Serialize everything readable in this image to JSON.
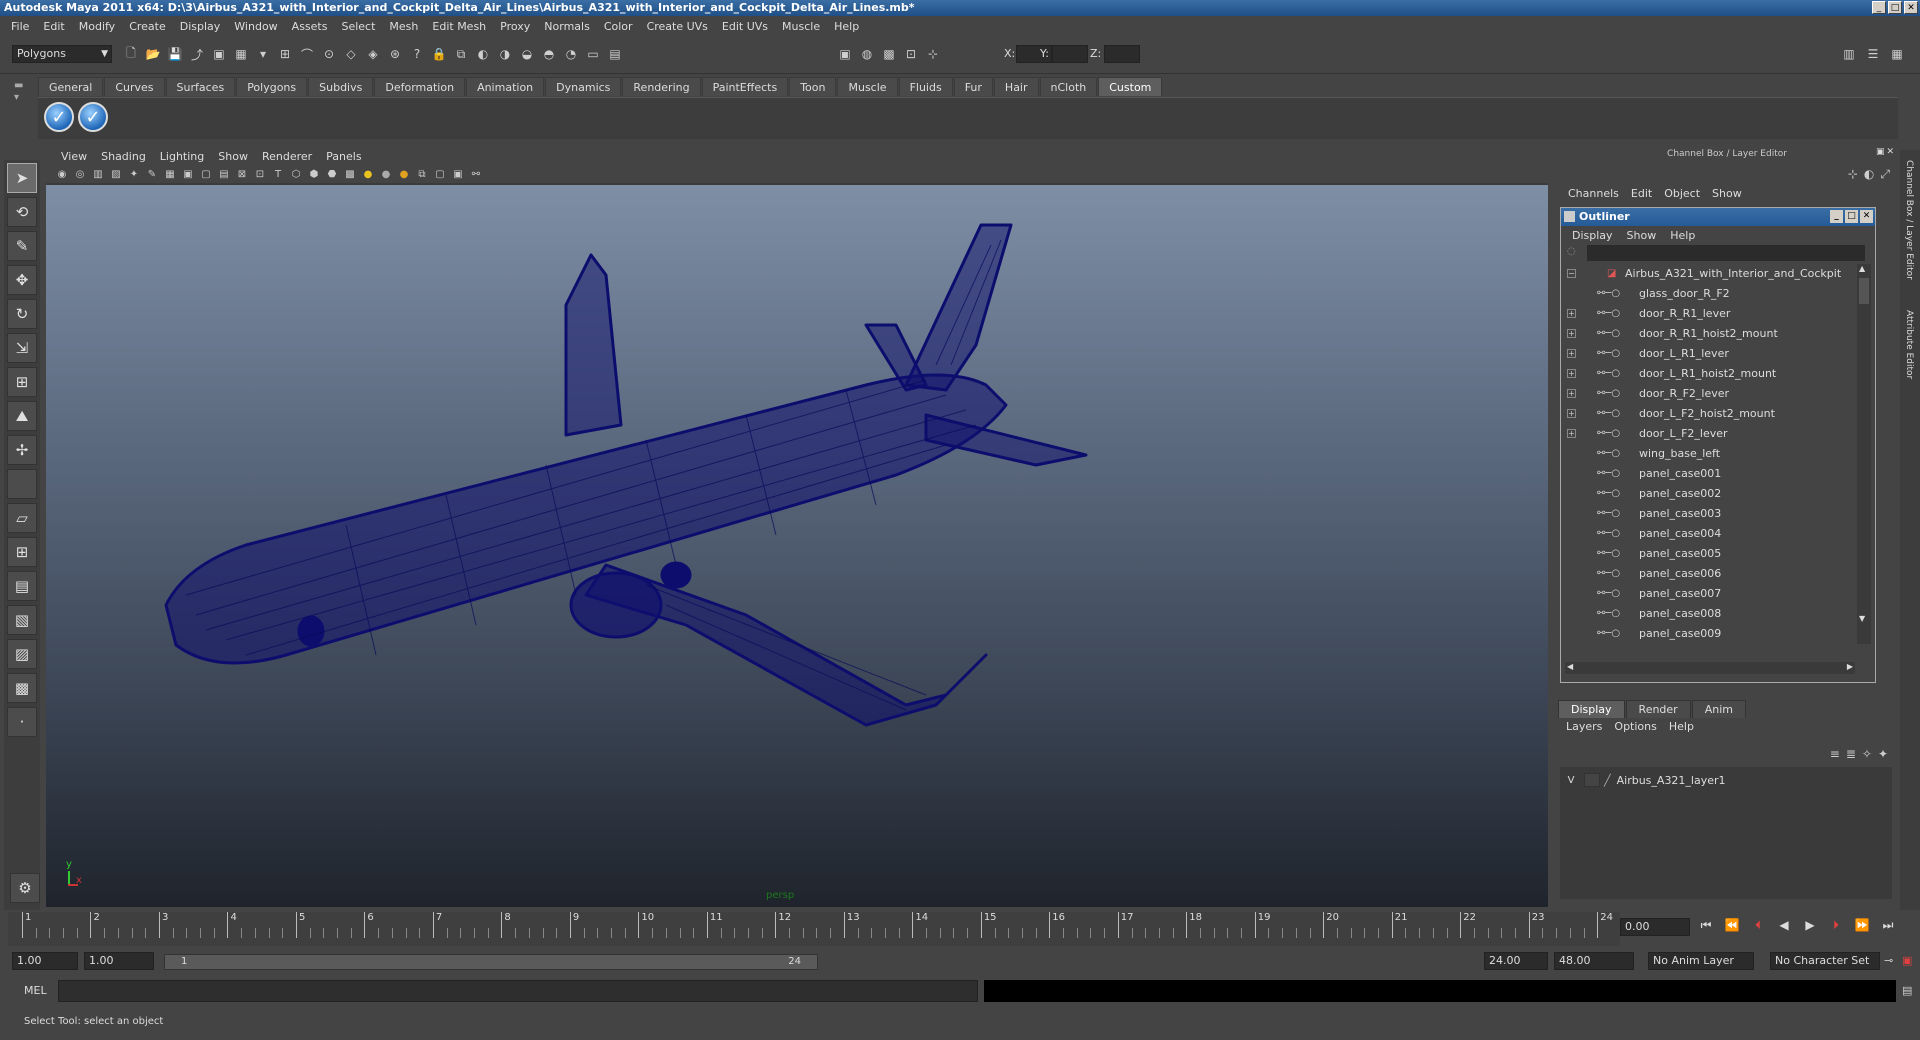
{
  "window": {
    "title": "Autodesk Maya 2011 x64: D:\\3\\Airbus_A321_with_Interior_and_Cockpit_Delta_Air_Lines\\Airbus_A321_with_Interior_and_Cockpit_Delta_Air_Lines.mb*"
  },
  "menubar": [
    "File",
    "Edit",
    "Modify",
    "Create",
    "Display",
    "Window",
    "Assets",
    "Select",
    "Mesh",
    "Edit Mesh",
    "Proxy",
    "Normals",
    "Color",
    "Create UVs",
    "Edit UVs",
    "Muscle",
    "Help"
  ],
  "statusline": {
    "mode": "Polygons",
    "x_label": "X:",
    "y_label": "Y:",
    "z_label": "Z:"
  },
  "shelf_tabs": [
    "General",
    "Curves",
    "Surfaces",
    "Polygons",
    "Subdivs",
    "Deformation",
    "Animation",
    "Dynamics",
    "Rendering",
    "PaintEffects",
    "Toon",
    "Muscle",
    "Fluids",
    "Fur",
    "Hair",
    "nCloth",
    "Custom"
  ],
  "shelf_active": "Custom",
  "viewport": {
    "menu": [
      "View",
      "Shading",
      "Lighting",
      "Show",
      "Renderer",
      "Panels"
    ],
    "camera_label": "persp",
    "axis_y": "y",
    "axis_x": "x"
  },
  "channel_box": {
    "title": "Channel Box / Layer Editor",
    "menu": [
      "Channels",
      "Edit",
      "Object",
      "Show"
    ],
    "side_tab_1": "Channel Box / Layer Editor",
    "side_tab_2": "Attribute Editor"
  },
  "outliner": {
    "title": "Outliner",
    "menu": [
      "Display",
      "Show",
      "Help"
    ],
    "root": "Airbus_A321_with_Interior_and_Cockpit",
    "items": [
      {
        "name": "glass_door_R_F2",
        "expandable": false
      },
      {
        "name": "door_R_R1_lever",
        "expandable": true
      },
      {
        "name": "door_R_R1_hoist2_mount",
        "expandable": true
      },
      {
        "name": "door_L_R1_lever",
        "expandable": true
      },
      {
        "name": "door_L_R1_hoist2_mount",
        "expandable": true
      },
      {
        "name": "door_R_F2_lever",
        "expandable": true
      },
      {
        "name": "door_L_F2_hoist2_mount",
        "expandable": true
      },
      {
        "name": "door_L_F2_lever",
        "expandable": true
      },
      {
        "name": "wing_base_left",
        "expandable": false
      },
      {
        "name": "panel_case001",
        "expandable": false
      },
      {
        "name": "panel_case002",
        "expandable": false
      },
      {
        "name": "panel_case003",
        "expandable": false
      },
      {
        "name": "panel_case004",
        "expandable": false
      },
      {
        "name": "panel_case005",
        "expandable": false
      },
      {
        "name": "panel_case006",
        "expandable": false
      },
      {
        "name": "panel_case007",
        "expandable": false
      },
      {
        "name": "panel_case008",
        "expandable": false
      },
      {
        "name": "panel_case009",
        "expandable": false
      }
    ]
  },
  "layer_editor": {
    "tabs": [
      "Display",
      "Render",
      "Anim"
    ],
    "active_tab": "Display",
    "menu": [
      "Layers",
      "Options",
      "Help"
    ],
    "layer_visible": "V",
    "layer_name": "Airbus_A321_layer1"
  },
  "timeline": {
    "ticks": [
      "1",
      "2",
      "3",
      "4",
      "5",
      "6",
      "7",
      "8",
      "9",
      "10",
      "11",
      "12",
      "13",
      "14",
      "15",
      "16",
      "17",
      "18",
      "19",
      "20",
      "21",
      "22",
      "23",
      "24"
    ],
    "current_time": "0.00"
  },
  "range": {
    "start": "1.00",
    "playback_start": "1.00",
    "slider_start": "1",
    "slider_end": "24",
    "playback_end": "24.00",
    "end": "48.00",
    "anim_layer": "No Anim Layer",
    "char_set": "No Character Set"
  },
  "command": {
    "label": "MEL"
  },
  "help_line": "Select Tool: select an object",
  "colors": {
    "wireframe": "#0d0d6e",
    "title_bar": "#245a96"
  }
}
